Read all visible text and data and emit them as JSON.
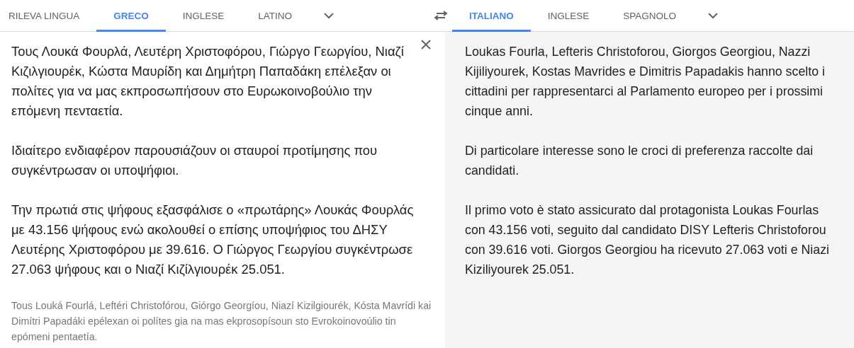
{
  "source_languages": [
    {
      "label": "RILEVA LINGUA",
      "selected": false
    },
    {
      "label": "GRECO",
      "selected": true
    },
    {
      "label": "INGLESE",
      "selected": false
    },
    {
      "label": "LATINO",
      "selected": false
    }
  ],
  "target_languages": [
    {
      "label": "ITALIANO",
      "selected": true
    },
    {
      "label": "INGLESE",
      "selected": false
    },
    {
      "label": "SPAGNOLO",
      "selected": false
    }
  ],
  "source": {
    "paragraphs": [
      "Τους Λουκά Φουρλά, Λευτέρη Χριστοφόρου, Γιώργο Γεωργίου, Νιαζί Κιζιλγιουρέκ, Κώστα Μαυρίδη και Δημήτρη Παπαδάκη επέλεξαν οι πολίτες για να μας εκπροσωπήσουν στο Ευρωκοινοβούλιο την επόμενη πενταετία.",
      "Ιδιαίτερο ενδιαφέρον παρουσιάζουν οι σταυροί προτίμησης  που συγκέντρωσαν οι υποψήφιοι.",
      "Την πρωτιά στις ψήφους εξασφάλισε ο «πρωτάρης» Λουκάς Φουρλάς με 43.156 ψήφους ενώ ακολουθεί ο επίσης  υποψήφιος του ΔΗΣΥ Λευτέρης Χριστοφόρου με 39.616. Ο Γιώργος Γεωργίου συγκέντρωσε 27.063 ψήφους και ο Νιαζί Κιζίλγιουρέκ 25.051."
    ],
    "transliteration": "Tous Louká Fourlá, Leftéri Christofórou, Giórgo Georgíou, Niazí Kizilgiourék, Kósta Mavrídi kai Dimítri Papadáki epélexan oi polítes gia na mas ekprosopísoun sto Evrokoinovoúlio tin epómeni pentaetía."
  },
  "translation": {
    "paragraphs": [
      "Loukas Fourla, Lefteris Christoforou, Giorgos Georgiou, Nazzi Kijiliyourek, Kostas Mavrides e Dimitris Papadakis hanno scelto i cittadini per rappresentarci al Parlamento europeo per i prossimi cinque anni.",
      "Di particolare interesse sono le croci di preferenza raccolte dai candidati.",
      "Il primo voto è stato assicurato dal protagonista Loukas Fourlas con 43.156 voti, seguito dal candidato DISY Lefteris Christoforou con 39.616 voti. Giorgos Georgiou ha ricevuto 27.063 voti e Niazi Kiziliyourek 25.051."
    ]
  }
}
